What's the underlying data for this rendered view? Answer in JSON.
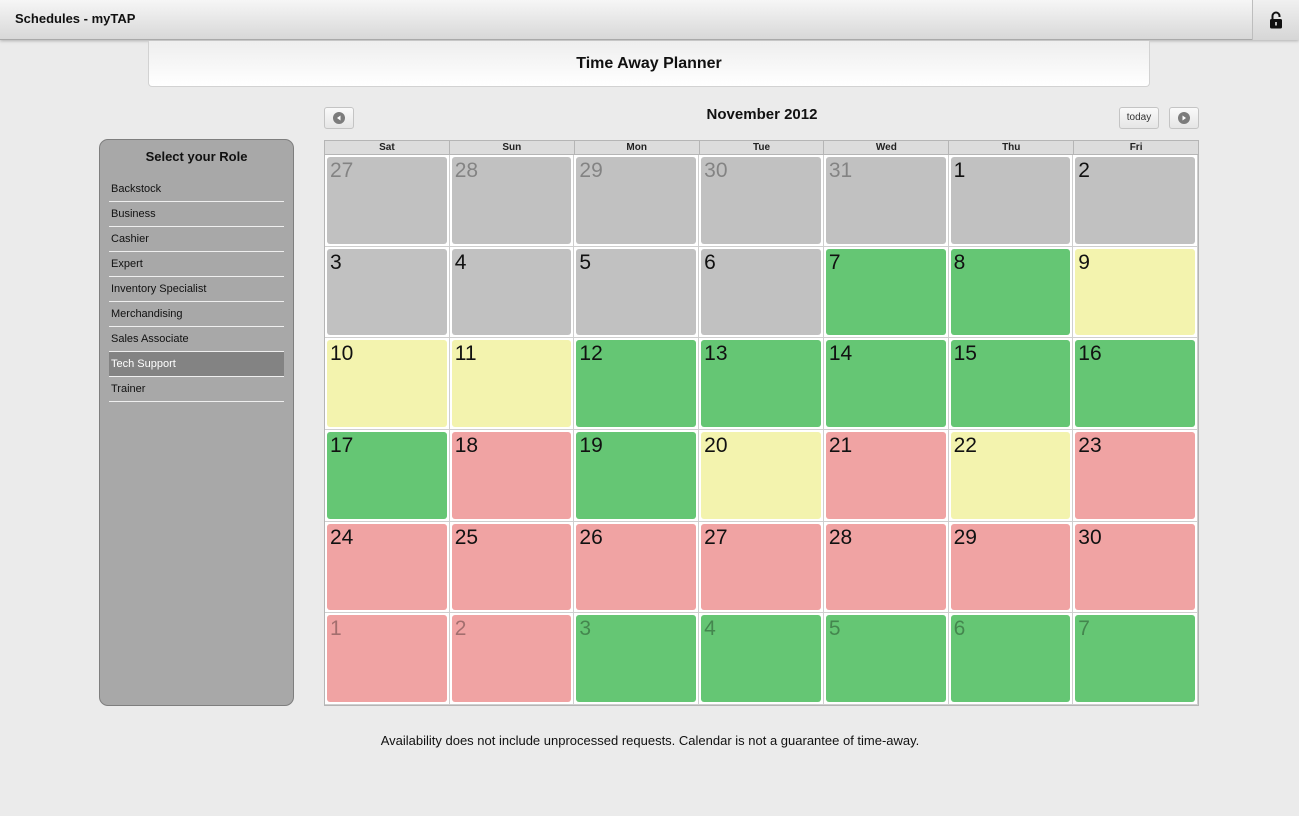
{
  "app": {
    "title": "Schedules - myTAP"
  },
  "header": {
    "title": "Time Away Planner"
  },
  "sidebar": {
    "title": "Select your Role",
    "roles": [
      {
        "label": "Backstock",
        "selected": false
      },
      {
        "label": "Business",
        "selected": false
      },
      {
        "label": "Cashier",
        "selected": false
      },
      {
        "label": "Expert",
        "selected": false
      },
      {
        "label": "Inventory Specialist",
        "selected": false
      },
      {
        "label": "Merchandising",
        "selected": false
      },
      {
        "label": "Sales Associate",
        "selected": false
      },
      {
        "label": "Tech Support",
        "selected": true
      },
      {
        "label": "Trainer",
        "selected": false
      }
    ]
  },
  "calendar": {
    "month_title": "November 2012",
    "today_label": "today",
    "weekdays": [
      "Sat",
      "Sun",
      "Mon",
      "Tue",
      "Wed",
      "Thu",
      "Fri"
    ],
    "status_colors": {
      "grey": "#c1c1c1",
      "green": "#65c674",
      "yellow": "#f3f3ae",
      "red": "#f0a3a3"
    },
    "weeks": [
      [
        {
          "day": "27",
          "status": "grey",
          "other": true
        },
        {
          "day": "28",
          "status": "grey",
          "other": true
        },
        {
          "day": "29",
          "status": "grey",
          "other": true
        },
        {
          "day": "30",
          "status": "grey",
          "other": true
        },
        {
          "day": "31",
          "status": "grey",
          "other": true
        },
        {
          "day": "1",
          "status": "grey",
          "other": false
        },
        {
          "day": "2",
          "status": "grey",
          "other": false
        }
      ],
      [
        {
          "day": "3",
          "status": "grey",
          "other": false
        },
        {
          "day": "4",
          "status": "grey",
          "other": false
        },
        {
          "day": "5",
          "status": "grey",
          "other": false
        },
        {
          "day": "6",
          "status": "grey",
          "other": false
        },
        {
          "day": "7",
          "status": "green",
          "other": false
        },
        {
          "day": "8",
          "status": "green",
          "other": false
        },
        {
          "day": "9",
          "status": "yellow",
          "other": false
        }
      ],
      [
        {
          "day": "10",
          "status": "yellow",
          "other": false
        },
        {
          "day": "11",
          "status": "yellow",
          "other": false
        },
        {
          "day": "12",
          "status": "green",
          "other": false
        },
        {
          "day": "13",
          "status": "green",
          "other": false
        },
        {
          "day": "14",
          "status": "green",
          "other": false
        },
        {
          "day": "15",
          "status": "green",
          "other": false
        },
        {
          "day": "16",
          "status": "green",
          "other": false
        }
      ],
      [
        {
          "day": "17",
          "status": "green",
          "other": false
        },
        {
          "day": "18",
          "status": "red",
          "other": false
        },
        {
          "day": "19",
          "status": "green",
          "other": false
        },
        {
          "day": "20",
          "status": "yellow",
          "other": false
        },
        {
          "day": "21",
          "status": "red",
          "other": false
        },
        {
          "day": "22",
          "status": "yellow",
          "other": false
        },
        {
          "day": "23",
          "status": "red",
          "other": false
        }
      ],
      [
        {
          "day": "24",
          "status": "red",
          "other": false
        },
        {
          "day": "25",
          "status": "red",
          "other": false
        },
        {
          "day": "26",
          "status": "red",
          "other": false
        },
        {
          "day": "27",
          "status": "red",
          "other": false
        },
        {
          "day": "28",
          "status": "red",
          "other": false
        },
        {
          "day": "29",
          "status": "red",
          "other": false
        },
        {
          "day": "30",
          "status": "red",
          "other": false
        }
      ],
      [
        {
          "day": "1",
          "status": "red",
          "other": true
        },
        {
          "day": "2",
          "status": "red",
          "other": true
        },
        {
          "day": "3",
          "status": "green",
          "other": true
        },
        {
          "day": "4",
          "status": "green",
          "other": true
        },
        {
          "day": "5",
          "status": "green",
          "other": true
        },
        {
          "day": "6",
          "status": "green",
          "other": true
        },
        {
          "day": "7",
          "status": "green",
          "other": true
        }
      ]
    ]
  },
  "footer": {
    "note": "Availability does not include unprocessed requests. Calendar is not a guarantee of time-away."
  },
  "icons": {
    "lock": "lock-icon",
    "prev": "chevron-left-icon",
    "next": "chevron-right-icon"
  }
}
